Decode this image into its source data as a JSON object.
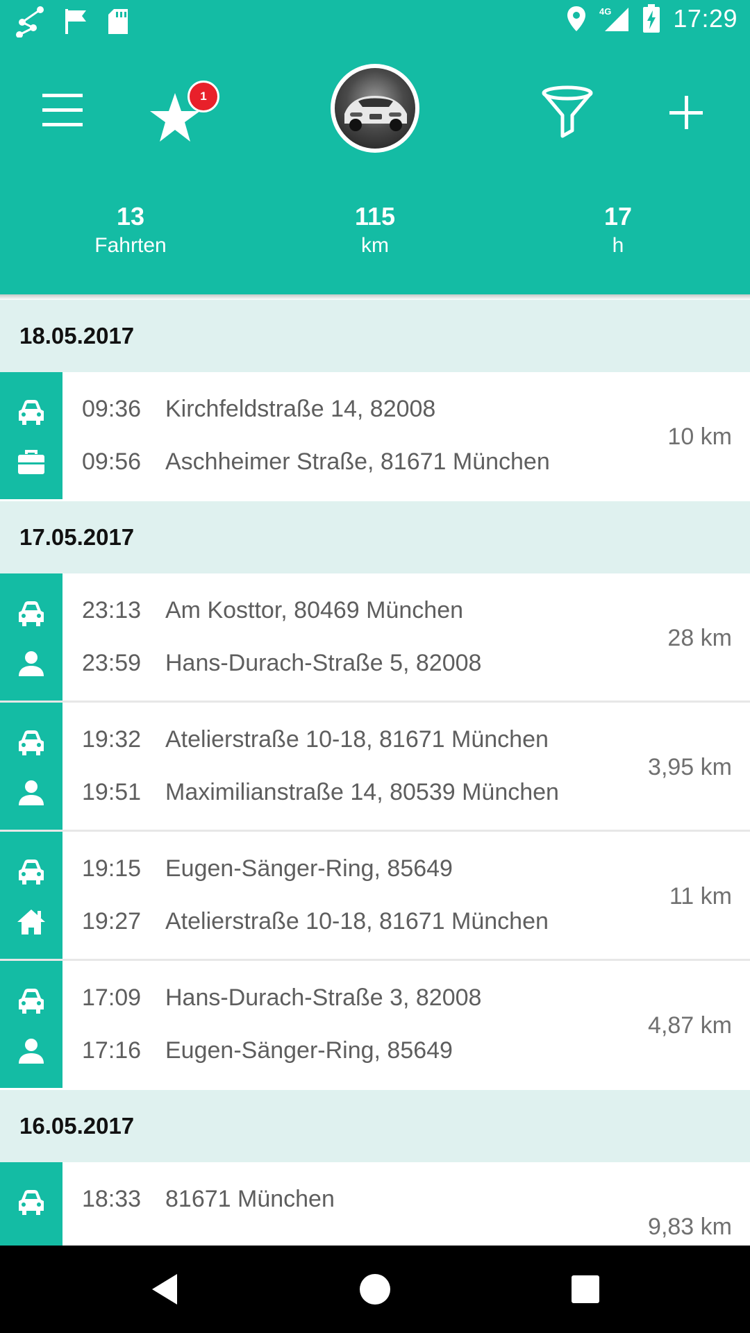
{
  "status_bar": {
    "time": "17:29",
    "network": "4G",
    "left_icons": [
      "route-icon",
      "flag-icon",
      "sd-card-icon"
    ],
    "right_icons": [
      "location-icon",
      "signal-icon",
      "battery-charging-icon"
    ]
  },
  "toolbar": {
    "favorites_badge": "1"
  },
  "stats": [
    {
      "value": "13",
      "unit": "Fahrten"
    },
    {
      "value": "115",
      "unit": "km"
    },
    {
      "value": "17",
      "unit": "h"
    }
  ],
  "groups": [
    {
      "date": "18.05.2017",
      "trips": [
        {
          "start_time": "09:36",
          "start_address": "Kirchfeldstraße 14, 82008",
          "end_time": "09:56",
          "end_address": "Aschheimer Straße, 81671 München",
          "distance": "10 km",
          "vehicle_icon": "car-icon",
          "category_icon": "briefcase-icon"
        }
      ]
    },
    {
      "date": "17.05.2017",
      "trips": [
        {
          "start_time": "23:13",
          "start_address": "Am Kosttor, 80469 München",
          "end_time": "23:59",
          "end_address": "Hans-Durach-Straße 5, 82008",
          "distance": "28 km",
          "vehicle_icon": "car-icon",
          "category_icon": "person-icon"
        },
        {
          "start_time": "19:32",
          "start_address": "Atelierstraße 10-18, 81671 München",
          "end_time": "19:51",
          "end_address": "Maximilianstraße 14, 80539 München",
          "distance": "3,95 km",
          "vehicle_icon": "car-icon",
          "category_icon": "person-icon"
        },
        {
          "start_time": "19:15",
          "start_address": "Eugen-Sänger-Ring, 85649",
          "end_time": "19:27",
          "end_address": "Atelierstraße 10-18, 81671 München",
          "distance": "11 km",
          "vehicle_icon": "car-icon",
          "category_icon": "home-icon"
        },
        {
          "start_time": "17:09",
          "start_address": "Hans-Durach-Straße 3, 82008",
          "end_time": "17:16",
          "end_address": "Eugen-Sänger-Ring, 85649",
          "distance": "4,87 km",
          "vehicle_icon": "car-icon",
          "category_icon": "person-icon"
        }
      ]
    },
    {
      "date": "16.05.2017",
      "trips": [
        {
          "start_time": "18:33",
          "start_address": "81671 München",
          "distance": "9,83 km",
          "vehicle_icon": "car-icon"
        }
      ]
    }
  ],
  "colors": {
    "primary": "#14bca4",
    "date_header_bg": "#dff1ef",
    "badge": "#e8202a",
    "nav_bar": "#000000"
  }
}
